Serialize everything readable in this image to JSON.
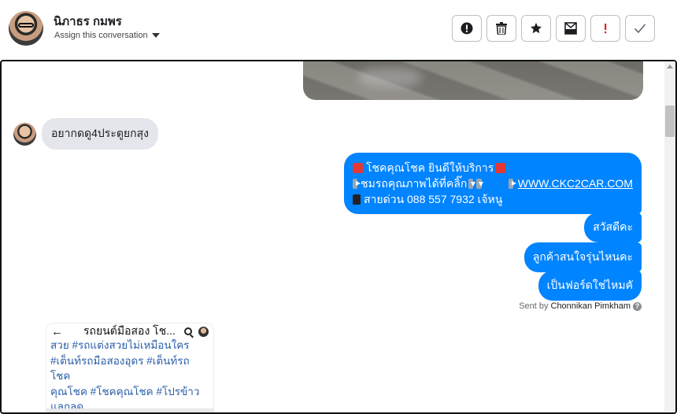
{
  "header": {
    "contact_name": "นิภาธร กมพร",
    "assign_label": "Assign this conversation"
  },
  "toolbar": {
    "buttons": [
      {
        "name": "mark-spam",
        "icon": "exclamation-circle-icon"
      },
      {
        "name": "delete",
        "icon": "trash-icon"
      },
      {
        "name": "star",
        "icon": "star-icon"
      },
      {
        "name": "archive",
        "icon": "archive-box-icon"
      },
      {
        "name": "flag-important",
        "icon": "exclamation-icon"
      },
      {
        "name": "mark-done",
        "icon": "checkmark-icon"
      }
    ]
  },
  "conversation": {
    "incoming_message": "อยากดดู4ประตูยกสุง",
    "promo_message": {
      "line1": "โชคคุณโชค ยินดีให้บริการ",
      "line2": "ชมรถคุณภาพได้ที่คลิ๊ก",
      "link": "WWW.CKC2CAR.COM",
      "line3": "สายด่วน 088 557 7932 เจ้หนู"
    },
    "outgoing_messages": [
      "สวัสดีคะ",
      "ลูกค้าสนใจรุ่นไหนคะ",
      "เป็นฟอร์ดใช่ไหมคั"
    ],
    "sent_by_label": "Sent by",
    "sent_by_name": "Chonnikan Pimkham",
    "help_glyph": "?"
  },
  "shared_card": {
    "back_glyph": "←",
    "title": "รถยนต์มือสอง โช...",
    "text_lines": [
      "สวย #รถแต่งสวยไม่เหมือนใคร",
      "#เต็นท์รถมือสองอุดร #เต็นท์รถโชค",
      "คุณโชค #โชคคุณโชค #โปรข้าว",
      "แลกลด"
    ]
  },
  "colors": {
    "accent_blue": "#0084ff",
    "incoming_bubble": "#e4e6eb",
    "card_text": "#2b5fa8",
    "flag_red": "#e02424"
  }
}
